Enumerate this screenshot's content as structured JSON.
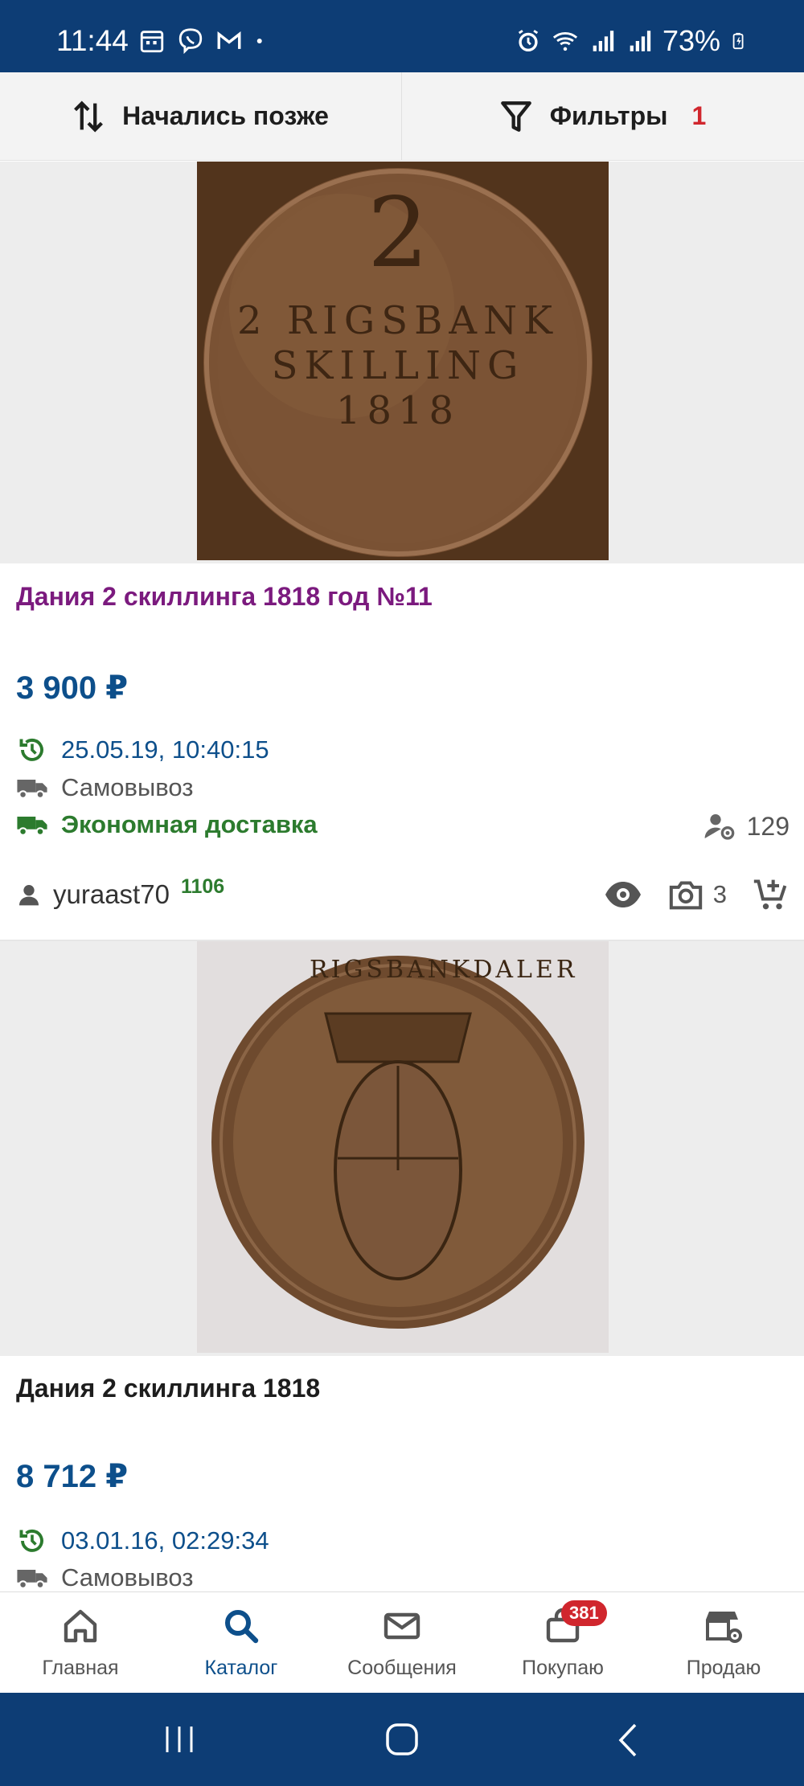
{
  "status_bar": {
    "time": "11:44",
    "battery": "73%",
    "left_icons": [
      "calendar-icon",
      "viber-icon",
      "gmail-icon",
      "dot-icon"
    ],
    "right_icons": [
      "alarm-icon",
      "wifi-icon",
      "signal-icon",
      "signal-icon",
      "battery-icon"
    ]
  },
  "toolbar": {
    "sort_label": "Начались позже",
    "filter_label": "Фильтры",
    "filter_count": "1"
  },
  "listings": [
    {
      "image_label": "2 RIGSBANK SKILLING 1818",
      "title": "Дания 2 скиллинга 1818 год №11",
      "title_color": "#7b1a7e",
      "price": "3 900 ₽",
      "date": "25.05.19, 10:40:15",
      "delivery_pickup": "Самовывоз",
      "delivery_economy": "Экономная доставка",
      "views": "129",
      "seller": "yuraast70",
      "seller_rating": "1106",
      "photo_count": "3"
    },
    {
      "image_label": "RIGSBANKDALER",
      "title": "Дания 2 скиллинга 1818",
      "title_color": "#1d1d1d",
      "price": "8 712 ₽",
      "date": "03.01.16, 02:29:34",
      "delivery_pickup": "Самовывоз"
    }
  ],
  "bottom_nav": {
    "items": [
      {
        "label": "Главная",
        "icon": "home-icon"
      },
      {
        "label": "Каталог",
        "icon": "search-icon"
      },
      {
        "label": "Сообщения",
        "icon": "mail-icon"
      },
      {
        "label": "Покупаю",
        "icon": "bag-icon",
        "badge": "381"
      },
      {
        "label": "Продаю",
        "icon": "store-settings-icon"
      }
    ]
  },
  "colors": {
    "brand_blue": "#0d3d75",
    "price_blue": "#0d4f8b",
    "green": "#2c7b2e",
    "red": "#d0262d"
  }
}
